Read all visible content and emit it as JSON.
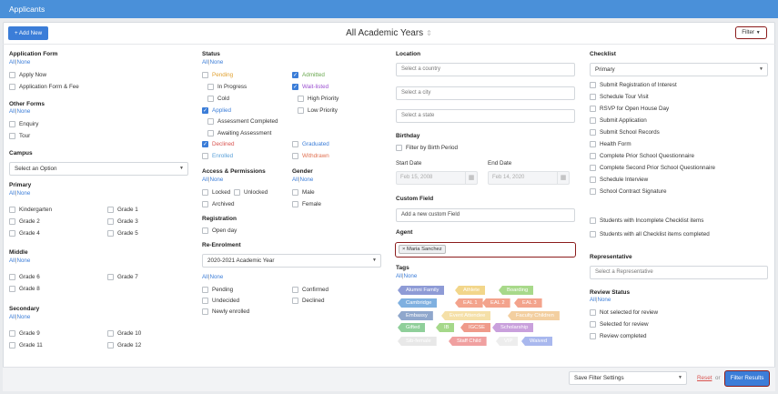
{
  "header": {
    "title": "Applicants"
  },
  "toolbar": {
    "add_label": "+ Add New",
    "view_title": "All Academic Years",
    "filter_label": "Filter"
  },
  "links": {
    "all": "All",
    "sep": "|",
    "none": "None"
  },
  "col1": {
    "application_form": {
      "heading": "Application Form",
      "items": [
        "Apply Now",
        "Application Form & Fee"
      ]
    },
    "other_forms": {
      "heading": "Other Forms",
      "items": [
        "Enquiry",
        "Tour"
      ]
    },
    "campus": {
      "heading": "Campus",
      "select": "Select an Option"
    },
    "primary": {
      "heading": "Primary",
      "items": [
        "Kindergarten",
        "Grade 1",
        "Grade 2",
        "Grade 3",
        "Grade 4",
        "Grade 5"
      ]
    },
    "middle": {
      "heading": "Middle",
      "items": [
        "Grade 6",
        "Grade 7",
        "Grade 8"
      ]
    },
    "secondary": {
      "heading": "Secondary",
      "items": [
        "Grade 9",
        "Grade 10",
        "Grade 11",
        "Grade 12"
      ]
    }
  },
  "col2": {
    "status": {
      "heading": "Status",
      "items": [
        {
          "label": "Pending",
          "color": "#e0a030",
          "checked": false
        },
        {
          "label": "Admitted",
          "color": "#6aa84f",
          "checked": true
        },
        {
          "label": "In Progress",
          "color": "#333333",
          "checked": false
        },
        {
          "label": "Wait-listed",
          "color": "#9b4fd0",
          "checked": true
        },
        {
          "label": "Cold",
          "color": "#333333",
          "checked": false
        },
        {
          "label": "High Priority",
          "color": "#333333",
          "checked": false
        },
        {
          "label": "Applied",
          "color": "#3b7dd8",
          "checked": true
        },
        {
          "label": "Low Priority",
          "color": "#333333",
          "checked": false
        },
        {
          "label": "Assessment Completed",
          "color": "#333333",
          "checked": false
        },
        {
          "label": "Awaiting Assessment",
          "color": "#333333",
          "checked": false
        },
        {
          "label": "Declined",
          "color": "#d9534f",
          "checked": true
        },
        {
          "label": "Graduated",
          "color": "#3b7dd8",
          "checked": false
        },
        {
          "label": "Enrolled",
          "color": "#5aa0d8",
          "checked": false
        },
        {
          "label": "Withdrawn",
          "color": "#e07050",
          "checked": false
        }
      ]
    },
    "access": {
      "heading": "Access & Permissions",
      "items": [
        "Locked",
        "Unlocked",
        "Archived"
      ]
    },
    "gender": {
      "heading": "Gender",
      "items": [
        "Male",
        "Female"
      ]
    },
    "registration": {
      "heading": "Registration",
      "items": [
        "Open day"
      ]
    },
    "reenrolment": {
      "heading": "Re-Enrolment",
      "select": "2020-2021 Academic Year",
      "items": [
        "Pending",
        "Confirmed",
        "Undecided",
        "Declined",
        "Newly enrolled"
      ]
    }
  },
  "col3": {
    "location": {
      "heading": "Location",
      "country": "Select a country",
      "city": "Select a city",
      "state": "Select a state"
    },
    "birthday": {
      "heading": "Birthday",
      "filter": "Filter by Birth Period",
      "start_label": "Start Date",
      "end_label": "End Date",
      "start_value": "Feb 15, 2008",
      "end_value": "Feb 14, 2020"
    },
    "custom_field": {
      "heading": "Custom Field",
      "placeholder": "Add a new custom Field"
    },
    "agent": {
      "heading": "Agent",
      "chip": "Maria Sanchez",
      "chip_x": "×"
    },
    "tags": {
      "heading": "Tags",
      "items": [
        {
          "label": "Alumni Family",
          "color": "#8e9bd6"
        },
        {
          "label": "Athlete",
          "color": "#f2d68a"
        },
        {
          "label": "Boarding",
          "color": "#a8d98a"
        },
        {
          "label": "Cambridge",
          "color": "#7fb0e0"
        },
        {
          "label": "EAL 1",
          "color": "#f3a38c"
        },
        {
          "label": "EAL 2",
          "color": "#f3a38c"
        },
        {
          "label": "EAL 3",
          "color": "#f3a38c"
        },
        {
          "label": "Embassy",
          "color": "#8fa7cc"
        },
        {
          "label": "Event Attendee",
          "color": "#f5e0a8"
        },
        {
          "label": "Faculty Children",
          "color": "#f3cfa0"
        },
        {
          "label": "Gifted",
          "color": "#8fcf9a"
        },
        {
          "label": "IB",
          "color": "#a5d88a"
        },
        {
          "label": "IGCSE",
          "color": "#ef9a8a"
        },
        {
          "label": "Scholarship",
          "color": "#c9a0dc"
        },
        {
          "label": "Sib-female",
          "color": "#e8e8e8"
        },
        {
          "label": "Staff Child",
          "color": "#f0a0a0"
        },
        {
          "label": "VIP",
          "color": "#ededed"
        },
        {
          "label": "Waived",
          "color": "#a9b8ee"
        }
      ]
    }
  },
  "col4": {
    "checklist": {
      "heading": "Checklist",
      "select": "Primary",
      "items": [
        "Submit Registration of Interest",
        "Schedule Tour Visit",
        "RSVP for Open House Day",
        "Submit Application",
        "Submit School Records",
        "Health Form",
        "Complete Prior School Questionnaire",
        "Complete Second Prior School Questionnaire",
        "Schedule Interview",
        "School Contract Signature"
      ],
      "extra": [
        "Students with Incomplete Checklist items",
        "Students with all Checklist items completed"
      ]
    },
    "representative": {
      "heading": "Representative",
      "placeholder": "Select a Representative"
    },
    "review": {
      "heading": "Review Status",
      "items": [
        "Not selected for review",
        "Selected for review",
        "Review completed"
      ]
    }
  },
  "footer": {
    "save_select": "Save Filter Settings",
    "reset": "Reset",
    "or": "or",
    "filter_results": "Filter Results"
  }
}
